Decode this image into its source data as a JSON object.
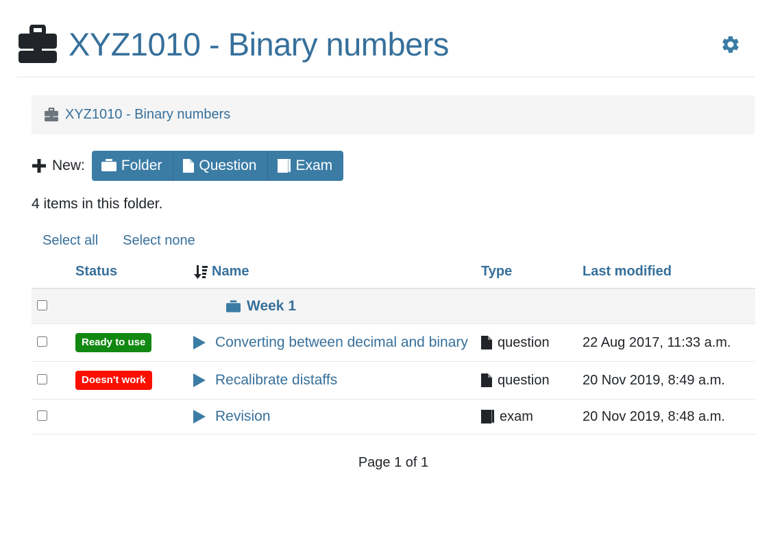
{
  "header": {
    "icon": "briefcase-icon",
    "title": "XYZ1010 - Binary numbers",
    "settings_icon": "gear-icon",
    "title_color": "#37709b"
  },
  "breadcrumb": {
    "icon": "briefcase-icon",
    "label": "XYZ1010 - Binary numbers"
  },
  "toolbar": {
    "plus_icon": "plus-icon",
    "new_label": "New:",
    "buttons": [
      {
        "label": "Folder",
        "icon": "folder-icon"
      },
      {
        "label": "Question",
        "icon": "file-icon"
      },
      {
        "label": "Exam",
        "icon": "book-icon"
      }
    ],
    "button_color": "#3b7ca5"
  },
  "listing": {
    "count_text": "4 items in this folder.",
    "select_all": "Select all",
    "select_none": "Select none",
    "columns": {
      "status": "Status",
      "name": "Name",
      "type": "Type",
      "last_modified": "Last modified",
      "sort_icon": "sort-amount-down-icon"
    },
    "rows": [
      {
        "kind": "folder",
        "status": "",
        "name": "Week 1",
        "type": "",
        "type_icon": "",
        "last_modified": ""
      },
      {
        "kind": "item",
        "status": "Ready to use",
        "status_style": "ok",
        "status_color": "#118811",
        "name": "Converting between decimal and binary",
        "type": "question",
        "type_icon": "file-icon",
        "last_modified": "22 Aug 2017, 11:33 a.m."
      },
      {
        "kind": "item",
        "status": "Doesn't work",
        "status_style": "fail",
        "status_color": "#fa0f00",
        "name": "Recalibrate distaffs",
        "type": "question",
        "type_icon": "file-icon",
        "last_modified": "20 Nov 2019, 8:49 a.m."
      },
      {
        "kind": "item",
        "status": "",
        "status_style": "",
        "status_color": "",
        "name": "Revision",
        "type": "exam",
        "type_icon": "book-icon",
        "last_modified": "20 Nov 2019, 8:48 a.m."
      }
    ]
  },
  "pager": {
    "text": "Page 1 of 1"
  }
}
